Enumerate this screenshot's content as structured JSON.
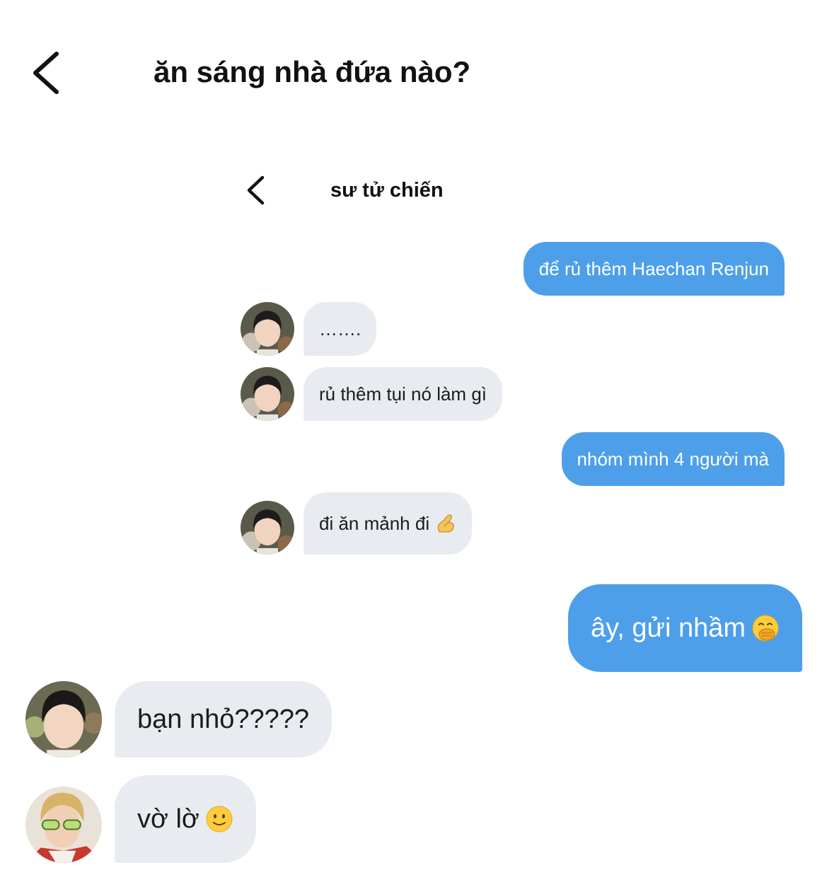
{
  "header": {
    "title": "ăn sáng nhà đứa nào?"
  },
  "embedded_chat": {
    "title": "sư tử chiến",
    "messages": [
      {
        "from": "me",
        "text": "để rủ thêm Haechan Renjun"
      },
      {
        "from": "them",
        "text": "……."
      },
      {
        "from": "them",
        "text": "rủ thêm tụi nó làm gì"
      },
      {
        "from": "me",
        "text": "nhóm mình 4 người mà"
      },
      {
        "from": "them",
        "text": "đi ăn mảnh đi",
        "emoji": "pinching-hand-emoji"
      }
    ]
  },
  "messages": [
    {
      "from": "me",
      "text": "ây, gửi nhầm",
      "emoji": "face-with-hand-over-mouth-emoji"
    },
    {
      "from": "them",
      "text": "bạn nhỏ?????"
    },
    {
      "from": "them",
      "text": "vờ lờ",
      "emoji": "slightly-smiling-face-emoji"
    }
  ],
  "colors": {
    "outgoing_bubble": "#4d9fea",
    "incoming_bubble": "#e8ecf1"
  }
}
